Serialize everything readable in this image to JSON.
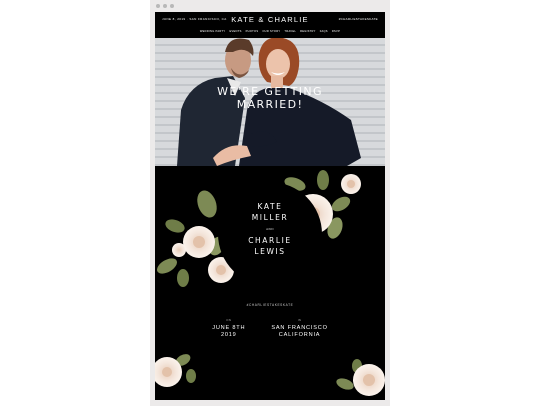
{
  "browser": {
    "controls": [
      "close",
      "minimize",
      "maximize"
    ]
  },
  "topbar": {
    "date_location": "JUNE 8, 2019 · SAN FRANCISCO, CA",
    "title": "KATE & CHARLIE",
    "hashtag": "#CHARLIESTAKESKATE",
    "nav": [
      "WEDDING PARTY",
      "EVENTS",
      "PHOTOS",
      "OUR STORY",
      "TRAVEL",
      "REGISTRY",
      "FAQS",
      "RSVP"
    ]
  },
  "hero": {
    "line1": "WE'RE GETTING",
    "line2": "MARRIED!"
  },
  "main": {
    "name1_first": "KATE",
    "name1_last": "MILLER",
    "and": "AND",
    "name2_first": "CHARLIE",
    "name2_last": "LEWIS",
    "hashtag": "#CHARLIESTAKESKATE",
    "date_label": "ON",
    "date_line1": "JUNE 8TH",
    "date_line2": "2019",
    "place_label": "IN",
    "place_line1": "SAN FRANCISCO",
    "place_line2": "CALIFORNIA"
  },
  "colors": {
    "background": "#000000",
    "rose": "#f4e6dc",
    "leaf": "#7d8a55",
    "text": "#ffffff"
  }
}
